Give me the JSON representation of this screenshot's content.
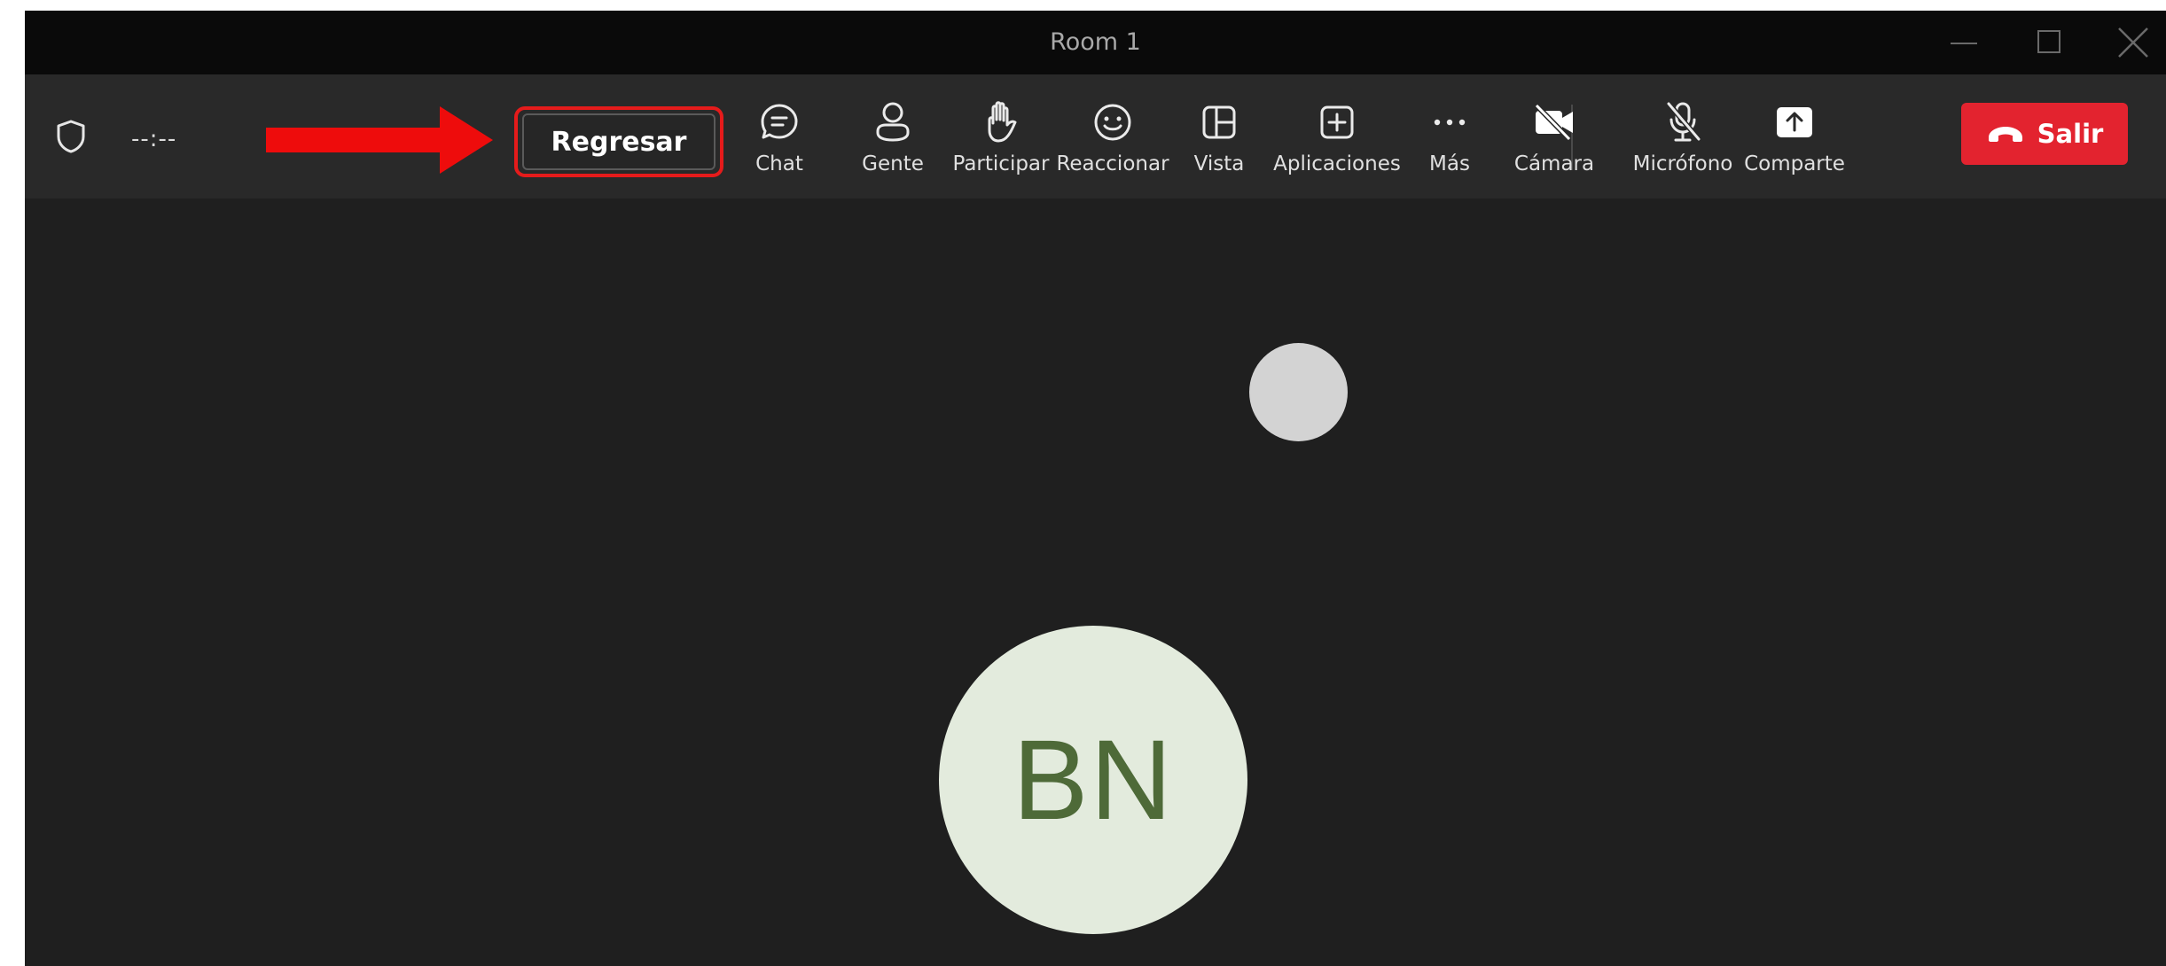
{
  "window": {
    "title": "Room 1"
  },
  "toolbar": {
    "timer": "--:--",
    "back_label": "Regresar",
    "chat_label": "Chat",
    "people_label": "Gente",
    "raise_label": "Participar",
    "react_label": "Reaccionar",
    "view_label": "Vista",
    "apps_label": "Aplicaciones",
    "more_label": "Más",
    "camera_label": "Cámara",
    "mic_label": "Micrófono",
    "share_label": "Comparte",
    "leave_label": "Salir"
  },
  "stage": {
    "participant_initials": "BN"
  },
  "icons": {
    "shield": "shield-icon",
    "chat": "chat-bubble-icon",
    "people": "person-icon",
    "raise": "raise-hand-icon",
    "react": "smiley-icon",
    "view": "grid-view-icon",
    "apps": "add-app-icon",
    "more": "ellipsis-icon",
    "camera": "camera-off-icon",
    "mic": "mic-off-icon",
    "share": "share-screen-icon",
    "leave": "phone-hangup-icon",
    "annotation": "red-arrow-icon"
  },
  "colors": {
    "leave_bg": "#e3232f",
    "highlight_border": "#e51b1b",
    "avatar_bg": "#e3ebdd",
    "avatar_text": "#4e6a38"
  }
}
